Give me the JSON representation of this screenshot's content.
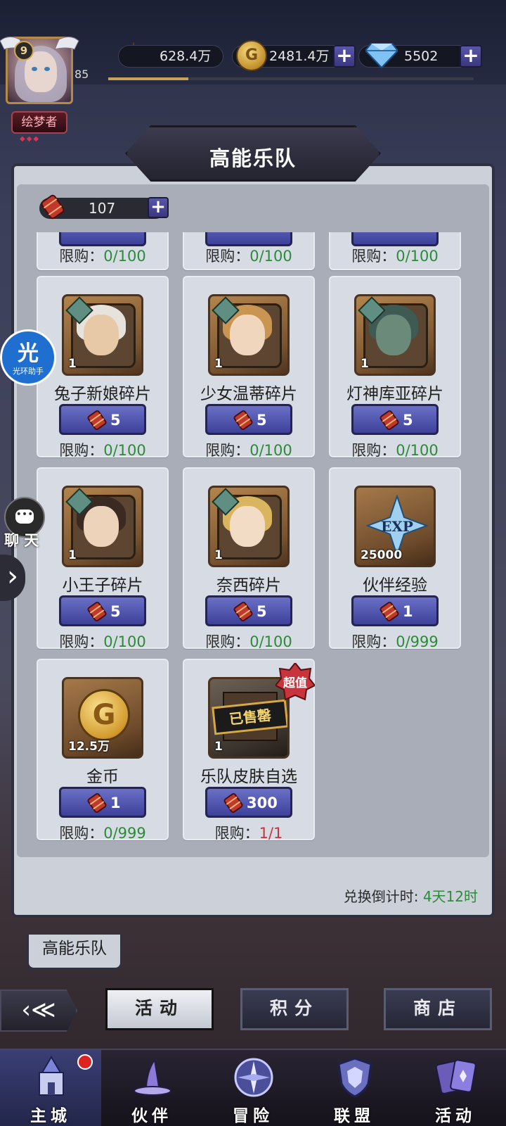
{
  "header": {
    "player_level": "9",
    "player_exp_level": "85",
    "player_title": "绘梦者",
    "exp_progress": 0.22,
    "power": "628.4万",
    "gold": "2481.4万",
    "gems": "5502"
  },
  "panel": {
    "title": "高能乐队",
    "ticket_count": "107",
    "countdown_label": "兑换倒计时: ",
    "countdown_value": "4天12时",
    "tab_label": "高能乐队"
  },
  "limit_prefix": "限购：",
  "partial_row": [
    {
      "limit": "0/100"
    },
    {
      "limit": "0/100"
    },
    {
      "limit": "0/100"
    }
  ],
  "items": [
    {
      "name": "兔子新娘碎片",
      "qty": "1",
      "price": "5",
      "limit": "0/100",
      "icon": "rabbit-bride-fragment-icon"
    },
    {
      "name": "少女温蒂碎片",
      "qty": "1",
      "price": "5",
      "limit": "0/100",
      "icon": "wendy-fragment-icon"
    },
    {
      "name": "灯神库亚碎片",
      "qty": "1",
      "price": "5",
      "limit": "0/100",
      "icon": "lamp-genie-fragment-icon"
    },
    {
      "name": "小王子碎片",
      "qty": "1",
      "price": "5",
      "limit": "0/100",
      "icon": "little-prince-fragment-icon"
    },
    {
      "name": "奈西碎片",
      "qty": "1",
      "price": "5",
      "limit": "0/100",
      "icon": "naixi-fragment-icon"
    },
    {
      "name": "伙伴经验",
      "qty": "25000",
      "price": "1",
      "limit": "0/999",
      "icon": "exp-icon",
      "exp_text": "EXP"
    },
    {
      "name": "金币",
      "qty": "12.5万",
      "price": "1",
      "limit": "0/999",
      "icon": "gold-coin-icon"
    },
    {
      "name": "乐队皮肤自选",
      "qty": "1",
      "price": "300",
      "limit": "1/1",
      "icon": "skin-gift-icon",
      "sold_out": "已售罄",
      "tag": "超值"
    }
  ],
  "side": {
    "assistant_char": "光",
    "assistant_label": "光环助手",
    "chat_label": "聊 天",
    "expand_arrow": "›"
  },
  "actions": {
    "back_icon": "‹≪",
    "activity": "活动",
    "points": "积分",
    "shop": "商店"
  },
  "tabs": [
    {
      "label": "主城",
      "icon": "castle-icon"
    },
    {
      "label": "伙伴",
      "icon": "witch-hat-icon"
    },
    {
      "label": "冒险",
      "icon": "compass-icon"
    },
    {
      "label": "联盟",
      "icon": "shield-icon"
    },
    {
      "label": "活动",
      "icon": "cards-icon"
    }
  ],
  "colors": {
    "accent_green": "#2d8a3a",
    "accent_red": "#c8343c",
    "button_blue": "#4a4fae"
  }
}
